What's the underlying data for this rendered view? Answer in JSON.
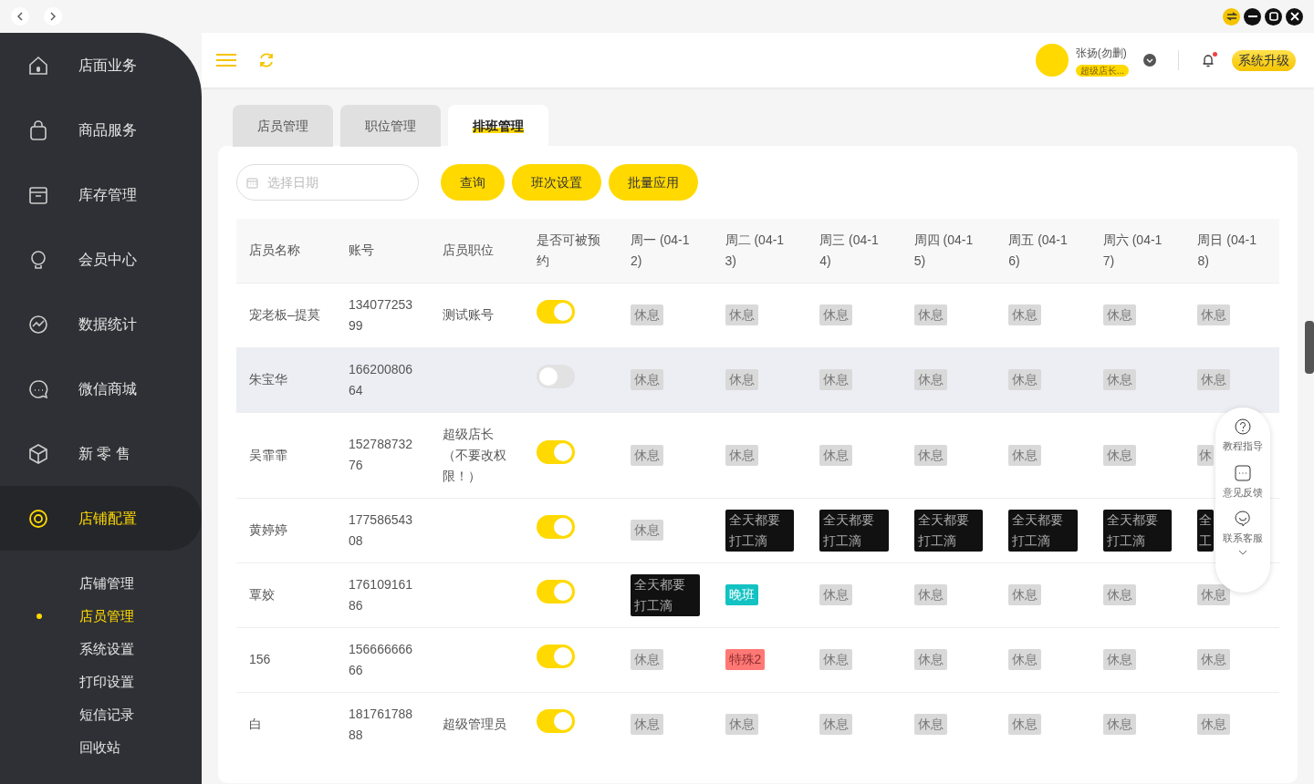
{
  "sidebar": {
    "items": [
      {
        "label": "店面业务",
        "selected": false
      },
      {
        "label": "商品服务",
        "selected": false
      },
      {
        "label": "库存管理",
        "selected": false
      },
      {
        "label": "会员中心",
        "selected": false
      },
      {
        "label": "数据统计",
        "selected": false
      },
      {
        "label": "微信商城",
        "selected": false
      },
      {
        "label": "新 零 售",
        "selected": false
      },
      {
        "label": "店铺配置",
        "selected": true,
        "children": [
          {
            "label": "店铺管理",
            "selected": false
          },
          {
            "label": "店员管理",
            "selected": true
          },
          {
            "label": "系统设置",
            "selected": false
          },
          {
            "label": "打印设置",
            "selected": false
          },
          {
            "label": "短信记录",
            "selected": false
          },
          {
            "label": "回收站",
            "selected": false
          }
        ]
      }
    ]
  },
  "header": {
    "user": {
      "name": "张扬(勿删)",
      "role": "超级店长..."
    },
    "notification_unread": true,
    "upgrade_button": "系统升级"
  },
  "tabs": [
    {
      "label": "店员管理",
      "selected": false
    },
    {
      "label": "职位管理",
      "selected": false
    },
    {
      "label": "排班管理",
      "selected": true
    }
  ],
  "toolbar": {
    "date_field": {
      "placeholder": "选择日期"
    },
    "buttons": [
      "查询",
      "班次设置",
      "批量应用"
    ]
  },
  "table": {
    "columns": [
      "店员名称",
      "账号",
      "店员职位",
      "是否可被预约",
      "周一 (04-12)",
      "周二 (04-13)",
      "周三 (04-14)",
      "周四 (04-15)",
      "周五 (04-16)",
      "周六 (04-17)",
      "周日 (04-18)"
    ],
    "rows": [
      {
        "name": "宠老板–提莫",
        "account": "13407725399",
        "position": "测试账号",
        "bookable": true,
        "selected": false,
        "shifts": [
          {
            "kind": "rest",
            "label": "休息"
          },
          {
            "kind": "rest",
            "label": "休息"
          },
          {
            "kind": "rest",
            "label": "休息"
          },
          {
            "kind": "rest",
            "label": "休息"
          },
          {
            "kind": "rest",
            "label": "休息"
          },
          {
            "kind": "rest",
            "label": "休息"
          },
          {
            "kind": "rest",
            "label": "休息"
          }
        ]
      },
      {
        "name": "朱宝华",
        "account": "16620080664",
        "position": "",
        "bookable": false,
        "selected": true,
        "shifts": [
          {
            "kind": "rest",
            "label": "休息"
          },
          {
            "kind": "rest",
            "label": "休息"
          },
          {
            "kind": "rest",
            "label": "休息"
          },
          {
            "kind": "rest",
            "label": "休息"
          },
          {
            "kind": "rest",
            "label": "休息"
          },
          {
            "kind": "rest",
            "label": "休息"
          },
          {
            "kind": "rest",
            "label": "休息"
          }
        ]
      },
      {
        "name": "吴霏霏",
        "account": "15278873276",
        "position": "超级店长（不要改权限！）",
        "bookable": true,
        "selected": false,
        "shifts": [
          {
            "kind": "rest",
            "label": "休息"
          },
          {
            "kind": "rest",
            "label": "休息"
          },
          {
            "kind": "rest",
            "label": "休息"
          },
          {
            "kind": "rest",
            "label": "休息"
          },
          {
            "kind": "rest",
            "label": "休息"
          },
          {
            "kind": "rest",
            "label": "休息"
          },
          {
            "kind": "rest",
            "label": "休",
            "partial": true
          }
        ]
      },
      {
        "name": "黄婷婷",
        "account": "17758654308",
        "position": "",
        "bookable": true,
        "selected": false,
        "shifts": [
          {
            "kind": "rest",
            "label": "休息"
          },
          {
            "kind": "all_day",
            "label": "全天都要打工滴"
          },
          {
            "kind": "all_day",
            "label": "全天都要打工滴"
          },
          {
            "kind": "all_day",
            "label": "全天都要打工滴"
          },
          {
            "kind": "all_day",
            "label": "全天都要打工滴"
          },
          {
            "kind": "all_day",
            "label": "全天都要打工滴"
          },
          {
            "kind": "all_day",
            "label": "全工",
            "partial": true
          }
        ]
      },
      {
        "name": "覃姣",
        "account": "17610916186",
        "position": "",
        "bookable": true,
        "selected": false,
        "shifts": [
          {
            "kind": "all_day",
            "label": "全天都要打工滴"
          },
          {
            "kind": "night",
            "label": "晚班"
          },
          {
            "kind": "rest",
            "label": "休息"
          },
          {
            "kind": "rest",
            "label": "休息"
          },
          {
            "kind": "rest",
            "label": "休息"
          },
          {
            "kind": "rest",
            "label": "休息"
          },
          {
            "kind": "rest",
            "label": "休息"
          }
        ]
      },
      {
        "name": "156",
        "account": "15666666666",
        "position": "",
        "bookable": true,
        "selected": false,
        "shifts": [
          {
            "kind": "rest",
            "label": "休息"
          },
          {
            "kind": "special",
            "label": "特殊2"
          },
          {
            "kind": "rest",
            "label": "休息"
          },
          {
            "kind": "rest",
            "label": "休息"
          },
          {
            "kind": "rest",
            "label": "休息"
          },
          {
            "kind": "rest",
            "label": "休息"
          },
          {
            "kind": "rest",
            "label": "休息"
          }
        ]
      },
      {
        "name": "白",
        "account": "18176178888",
        "position": "超级管理员",
        "bookable": true,
        "selected": false,
        "shifts": [
          {
            "kind": "rest",
            "label": "休息"
          },
          {
            "kind": "rest",
            "label": "休息"
          },
          {
            "kind": "rest",
            "label": "休息"
          },
          {
            "kind": "rest",
            "label": "休息"
          },
          {
            "kind": "rest",
            "label": "休息"
          },
          {
            "kind": "rest",
            "label": "休息"
          },
          {
            "kind": "rest",
            "label": "休息"
          }
        ]
      }
    ]
  },
  "help_panel": {
    "items": [
      "教程指导",
      "意见反馈",
      "联系客服"
    ]
  }
}
